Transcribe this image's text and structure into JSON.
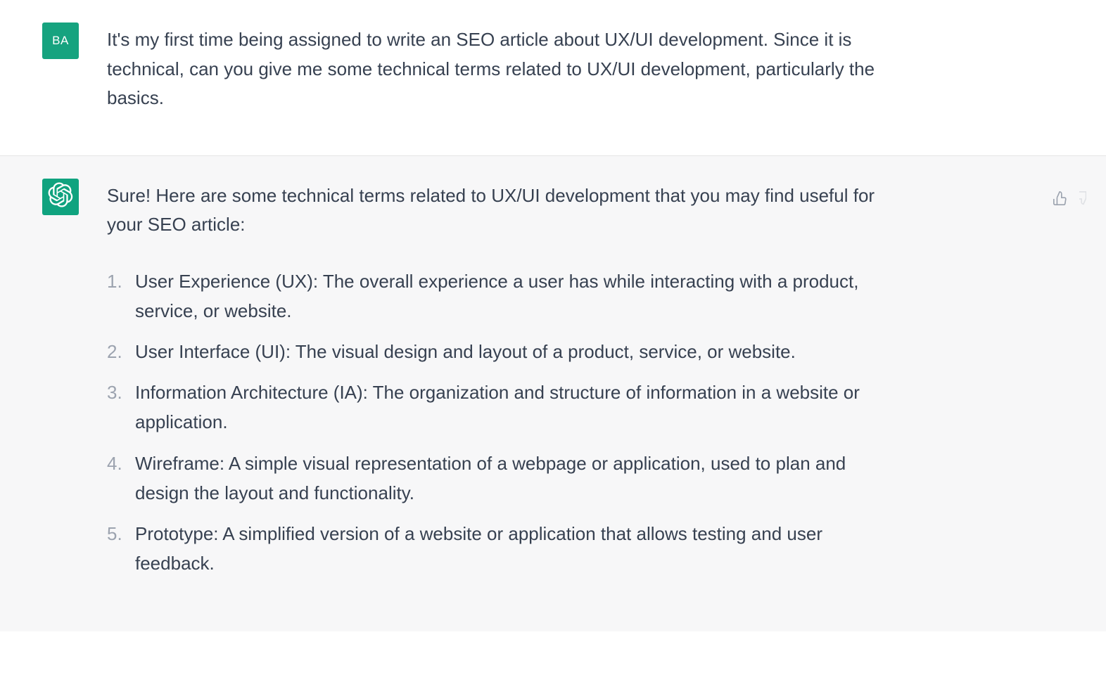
{
  "user": {
    "avatar_initials": "BA",
    "message": "It's my first time being assigned to write an SEO article about UX/UI development. Since it is technical, can you give me some technical terms related to UX/UI development, particularly the basics."
  },
  "assistant": {
    "intro": "Sure! Here are some technical terms related to UX/UI development that you may find useful for your SEO article:",
    "terms": [
      "User Experience (UX): The overall experience a user has while interacting with a product, service, or website.",
      "User Interface (UI): The visual design and layout of a product, service, or website.",
      "Information Architecture (IA): The organization and structure of information in a website or application.",
      "Wireframe: A simple visual representation of a webpage or application, used to plan and design the layout and functionality.",
      "Prototype: A simplified version of a website or application that allows testing and user feedback."
    ]
  }
}
